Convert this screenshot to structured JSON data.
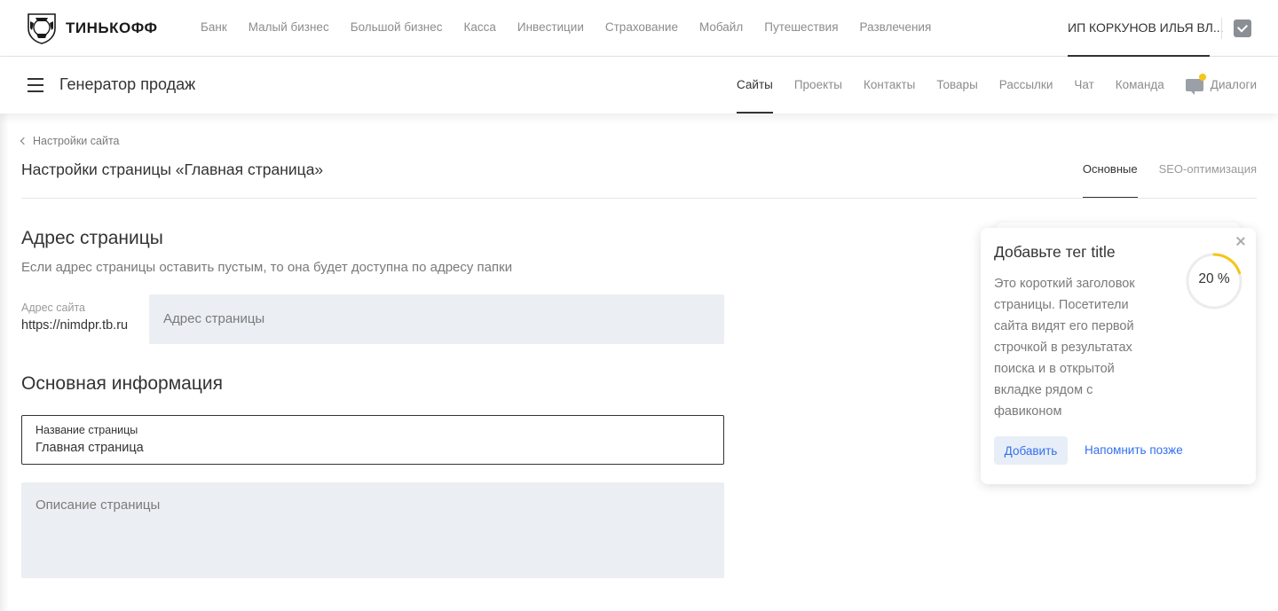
{
  "colors": {
    "accent": "#336fee",
    "progress": "#f5c518",
    "field_bg": "#ebeff3",
    "text_primary": "#333333",
    "text_secondary": "#7a7a7a"
  },
  "topbar": {
    "brand": "ТИНЬКОФФ",
    "logo_icon": "tinkoff-emblem-icon",
    "nav": [
      "Банк",
      "Малый бизнес",
      "Большой бизнес",
      "Касса",
      "Инвестиции",
      "Страхование",
      "Мобайл",
      "Путешествия",
      "Развлечения"
    ],
    "account_name": "ИП КОРКУНОВ ИЛЬЯ ВЛ...",
    "account_icon": "checkmark-icon"
  },
  "productbar": {
    "menu_icon": "burger-menu-icon",
    "title": "Генератор продаж",
    "nav": [
      {
        "label": "Сайты",
        "active": true
      },
      {
        "label": "Проекты",
        "active": false
      },
      {
        "label": "Контакты",
        "active": false
      },
      {
        "label": "Товары",
        "active": false
      },
      {
        "label": "Рассылки",
        "active": false
      },
      {
        "label": "Чат",
        "active": false
      },
      {
        "label": "Команда",
        "active": false
      }
    ],
    "dialogs_label": "Диалоги",
    "dialogs_icon": "chat-icon"
  },
  "page": {
    "breadcrumb": "Настройки сайта",
    "title": "Настройки страницы «Главная страница»",
    "tabs": [
      {
        "label": "Основные",
        "active": true
      },
      {
        "label": "SEO-оптимизация",
        "active": false
      }
    ]
  },
  "address": {
    "title": "Адрес страницы",
    "description": "Если адрес страницы оставить пустым, то она будет доступна по адресу папки",
    "site_label": "Адрес сайта",
    "site_value": "https://nimdpr.tb.ru",
    "placeholder": "Адрес страницы"
  },
  "info": {
    "title": "Основная информация",
    "name_label": "Название страницы",
    "name_value": "Главная страница",
    "description_placeholder": "Описание страницы"
  },
  "popup": {
    "title": "Добавьте тег title",
    "text": "Это короткий заголовок страницы. Посетители сайта видят его первой строчкой в результатах поиска и в открытой вкладке рядом с фавиконом",
    "progress_value": 0.2,
    "progress_label": "20 %",
    "add_label": "Добавить",
    "later_label": "Напомнить позже",
    "close_icon": "close-icon"
  }
}
